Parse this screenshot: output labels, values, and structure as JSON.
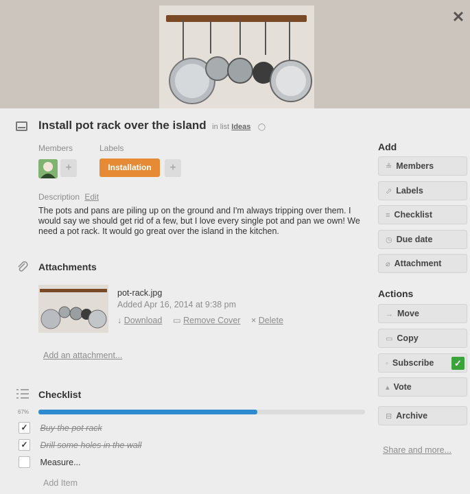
{
  "card": {
    "title": "Install pot rack over the island",
    "in_list_prefix": "in list",
    "list_name": "Ideas",
    "close_glyph": "✕"
  },
  "members": {
    "label": "Members",
    "add_glyph": "+"
  },
  "labels": {
    "label": "Labels",
    "items": [
      "Installation"
    ],
    "add_glyph": "+",
    "color": "#e68a35"
  },
  "description": {
    "label": "Description",
    "edit": "Edit",
    "text": "The pots and pans are piling up on the ground and I'm always tripping over them. I would say we should get rid of a few, but I love every single pot and pan we own! We need a pot rack. It would go great over the island in the kitchen."
  },
  "attachments": {
    "title": "Attachments",
    "file_name": "pot-rack.jpg",
    "added": "Added Apr 16, 2014 at 9:38 pm",
    "download": "Download",
    "remove_cover": "Remove Cover",
    "delete": "Delete",
    "add_link": "Add an attachment..."
  },
  "checklist": {
    "title": "Checklist",
    "progress_text": "67%",
    "progress": 0.67,
    "items": [
      {
        "text": "Buy the pot rack",
        "checked": true
      },
      {
        "text": "Drill some holes in the wall",
        "checked": true
      },
      {
        "text": "Measure...",
        "checked": false
      }
    ],
    "add_item": "Add Item"
  },
  "sidebar": {
    "add_heading": "Add",
    "add_buttons": [
      {
        "label": "Members",
        "icon": "member-icon"
      },
      {
        "label": "Labels",
        "icon": "tag-icon"
      },
      {
        "label": "Checklist",
        "icon": "checklist-icon"
      },
      {
        "label": "Due date",
        "icon": "clock-icon"
      },
      {
        "label": "Attachment",
        "icon": "paperclip-icon"
      }
    ],
    "actions_heading": "Actions",
    "action_buttons": [
      {
        "label": "Move",
        "icon": "arrow-right-icon"
      },
      {
        "label": "Copy",
        "icon": "copy-icon"
      },
      {
        "label": "Subscribe",
        "icon": "eye-icon"
      },
      {
        "label": "Vote",
        "icon": "thumbs-up-icon"
      },
      {
        "label": "Archive",
        "icon": "archive-icon"
      }
    ],
    "share": "Share and more..."
  }
}
